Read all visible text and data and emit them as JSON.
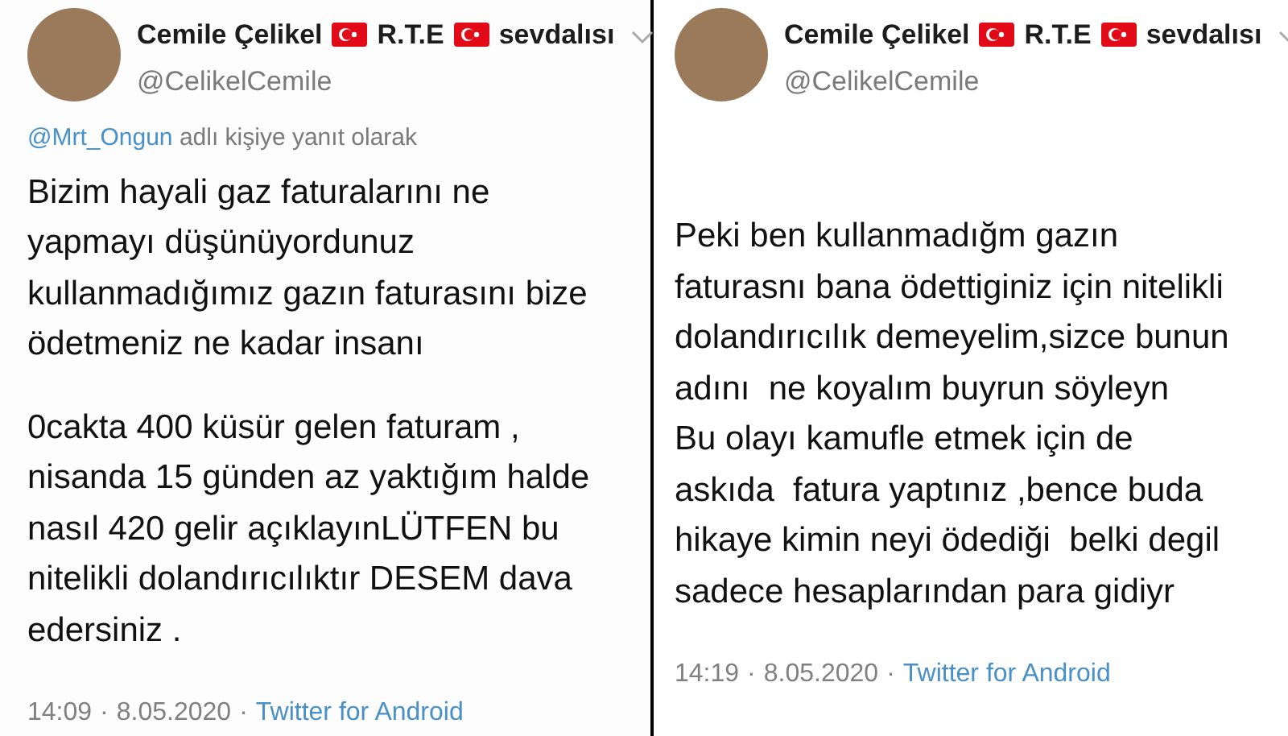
{
  "tweets": [
    {
      "author": {
        "name_parts": [
          "Cemile Çelikel",
          "R.T.E",
          "sevdalısı"
        ],
        "handle": "@CelikelCemile"
      },
      "reply_to": {
        "handle": "@Mrt_Ongun",
        "text": "adlı kişiye yanıt olarak"
      },
      "paragraphs": [
        [
          "Bizim hayali gaz faturalarını ne",
          "yapmayı düşünüyordunuz",
          "kullanmadığımız gazın faturasını bize",
          "ödetmeniz ne kadar insanı"
        ],
        [
          "0cakta 400 küsür gelen faturam ,",
          "nisanda 15 günden az yaktığım halde",
          "nasıl 420 gelir açıklayınLÜTFEN bu",
          "nitelikli dolandırıcılıktır DESEM dava",
          "edersiniz ."
        ]
      ],
      "time": "14:09",
      "separator": "·",
      "date": "8.05.2020",
      "source": "Twitter for Android"
    },
    {
      "author": {
        "name_parts": [
          "Cemile Çelikel",
          "R.T.E",
          "sevdalısı"
        ],
        "handle": "@CelikelCemile"
      },
      "paragraphs": [
        [
          "Peki ben kullanmadığm gazın",
          "faturasnı bana ödettiginiz için nitelikli",
          "dolandırıcılık demeyelim,sizce bunun",
          "adını  ne koyalım buyrun söyleyn",
          "Bu olayı kamufle etmek için de",
          "askıda  fatura yaptınız ,bence buda",
          "hikaye kimin neyi ödediği  belki degil",
          "sadece hesaplarından para gidiyr"
        ]
      ],
      "time": "14:19",
      "separator": "·",
      "date": "8.05.2020",
      "source": "Twitter for Android"
    }
  ]
}
